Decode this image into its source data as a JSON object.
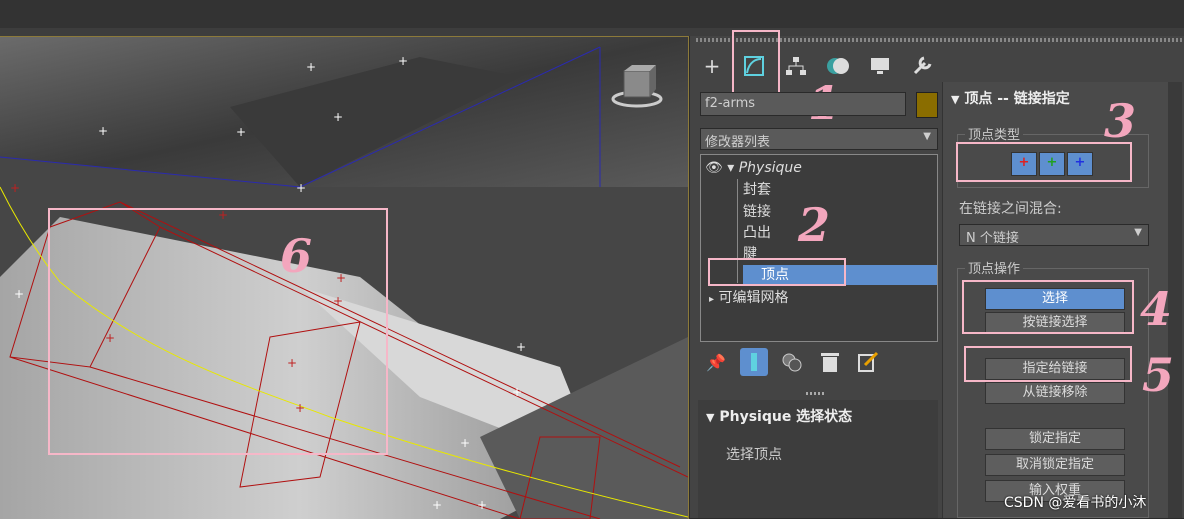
{
  "modifier": {
    "object_name": "f2-arms",
    "list_label": "修改器列表",
    "stack": [
      {
        "label": "Physique",
        "italic": true
      },
      {
        "label": "封套"
      },
      {
        "label": "链接"
      },
      {
        "label": "凸出"
      },
      {
        "label": "腱"
      },
      {
        "label": "顶点",
        "selected": true
      },
      {
        "label": "可编辑网格"
      }
    ],
    "rollout_title": "Physique 选择状态",
    "selected_label": "选择顶点"
  },
  "right": {
    "rollout_title": "顶点 -- 链接指定",
    "vertex_type_label": "顶点类型",
    "blend_label": "在链接之间混合:",
    "blend_value": "N 个链接",
    "ops_label": "顶点操作",
    "buttons": {
      "select": "选择",
      "select_by_link": "按链接选择",
      "assign_to_link": "指定给链接",
      "remove_from_link": "从链接移除",
      "lock": "锁定指定",
      "unlock": "取消锁定指定",
      "type_in": "输入权重"
    }
  },
  "annotations": [
    "1",
    "2",
    "3",
    "4",
    "5",
    "6"
  ],
  "watermark": "CSDN @爱看书的小沐",
  "colors": {
    "highlight": "#5e8fcf",
    "annotation": "#f3a6bd",
    "swatch": "#8a6d00"
  }
}
